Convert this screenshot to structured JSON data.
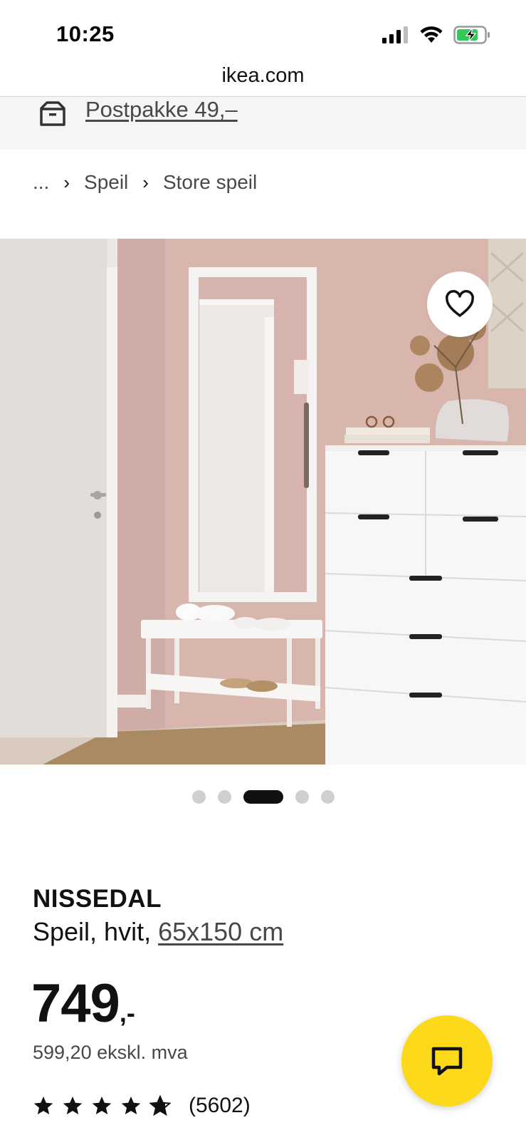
{
  "status_bar": {
    "time": "10:25",
    "icons": [
      "cellular-signal-icon",
      "wifi-icon",
      "battery-charging-icon"
    ]
  },
  "browser": {
    "url": "ikea.com"
  },
  "delivery_banner": {
    "icon": "package-icon",
    "label": "Postpakke 49,–"
  },
  "breadcrumb": {
    "items": [
      "...",
      "Speil",
      "Store speil"
    ],
    "separator_icon": "chevron-right-icon"
  },
  "gallery": {
    "favorite_icon": "heart-icon",
    "dot_count": 5,
    "active_dot_index": 2
  },
  "product": {
    "name": "NISSEDAL",
    "description_prefix": "Speil, hvit, ",
    "size": "65x150 cm",
    "price_main": "749",
    "price_suffix": ",-",
    "price_ex_vat": "599,20 ekskl. mva",
    "rating_stars": 4.5,
    "rating_max": 5,
    "rating_count": "(5602)"
  },
  "chat": {
    "icon": "chat-bubble-icon",
    "color": "#fcd91a"
  },
  "colors": {
    "wall": "#d8b5ad",
    "accent_yellow": "#fcd91a",
    "battery_green": "#34c759"
  }
}
